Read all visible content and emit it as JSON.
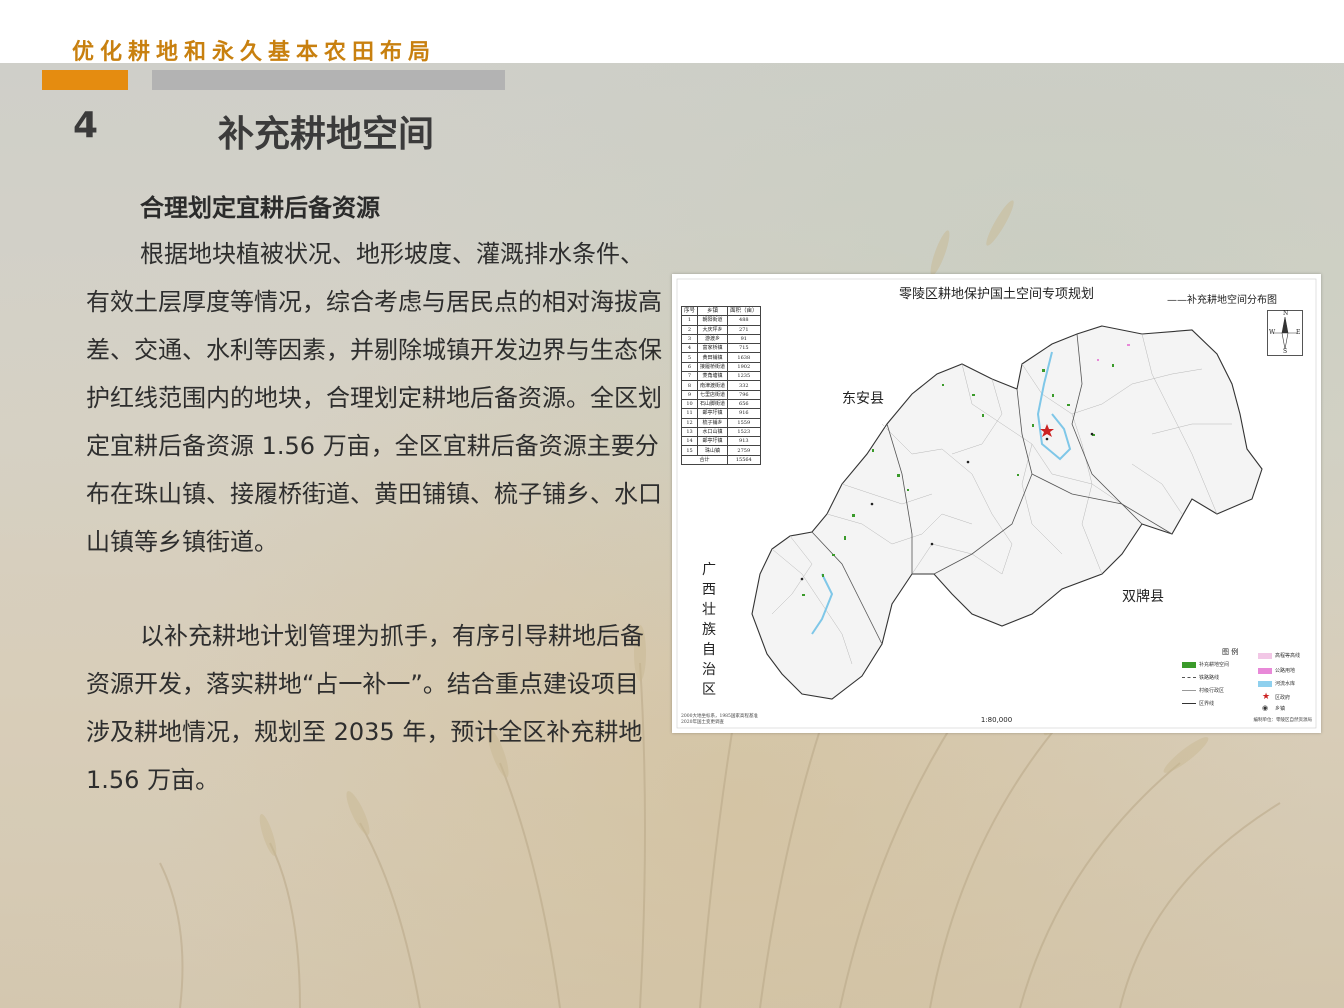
{
  "header": {
    "title": "优化耕地和永久基本农田布局"
  },
  "section": {
    "number": "4",
    "title": "补充耕地空间"
  },
  "content": {
    "subheading": "合理划定宜耕后备资源",
    "paragraph1": "根据地块植被状况、地形坡度、灌溉排水条件、有效土层厚度等情况，综合考虑与居民点的相对海拔高差、交通、水利等因素，并剔除城镇开发边界与生态保护红线范围内的地块，合理划定耕地后备资源。全区划定宜耕后备资源 1.56 万亩，全区宜耕后备资源主要分布在珠山镇、接履桥街道、黄田铺镇、梳子铺乡、水口山镇等乡镇街道。",
    "paragraph2": "以补充耕地计划管理为抓手，有序引导耕地后备资源开发，落实耕地“占一补一”。结合重点建设项目涉及耕地情况，规划至 2035 年，预计全区补充耕地 1.56 万亩。"
  },
  "map": {
    "title": "零陵区耕地保护国土空间专项规划",
    "subtitle": "——补充耕地空间分布图",
    "table": {
      "headers": [
        "序号",
        "乡镇",
        "面积（亩）"
      ],
      "rows": [
        [
          "1",
          "朝阳街道",
          "488"
        ],
        [
          "2",
          "大庆坪乡",
          "271"
        ],
        [
          "3",
          "游渡乡",
          "91"
        ],
        [
          "4",
          "富家桥镇",
          "715"
        ],
        [
          "5",
          "黄田铺镇",
          "1638"
        ],
        [
          "6",
          "接履桥街道",
          "1902"
        ],
        [
          "7",
          "菱角塘镇",
          "1235"
        ],
        [
          "8",
          "南津渡街道",
          "332"
        ],
        [
          "9",
          "七里店街道",
          "796"
        ],
        [
          "10",
          "石山脚街道",
          "656"
        ],
        [
          "11",
          "邮亭圩镇",
          "916"
        ],
        [
          "12",
          "梳子铺乡",
          "1559"
        ],
        [
          "13",
          "水口山镇",
          "1523"
        ],
        [
          "14",
          "邮亭圩镇",
          "913"
        ],
        [
          "15",
          "珠山镇",
          "2759"
        ]
      ],
      "total_label": "合计",
      "total_value": "15564"
    },
    "neighbors": {
      "dongan": "东安县",
      "shuangpai": "双牌县",
      "guangxi": "广西壮族自治区"
    },
    "compass": {
      "n": "N",
      "s": "S",
      "e": "E",
      "w": "W"
    },
    "legend": {
      "title": "图 例",
      "items": [
        {
          "label": "补充耕地空间",
          "color": "#3a9a2a"
        },
        {
          "label": "铁路路线",
          "color": "#555555"
        },
        {
          "label": "村级行政区",
          "color": "#999999"
        },
        {
          "label": "区界线",
          "color": "#333333"
        },
        {
          "label": "高程等高线",
          "color": "#f2c7e6"
        },
        {
          "label": "公路用地",
          "color": "#e889d8"
        },
        {
          "label": "河流水库",
          "color": "#8fd0ee"
        },
        {
          "label": "区政府",
          "color": "#cc2222"
        },
        {
          "label": "乡镇",
          "color": "#222222"
        }
      ]
    },
    "scale": "1:80,000",
    "note_left": [
      "2000大地坐标系，1985国家高程基准",
      "2020年国土变更调查"
    ],
    "note_right": "编制单位：零陵区自然资源局"
  }
}
